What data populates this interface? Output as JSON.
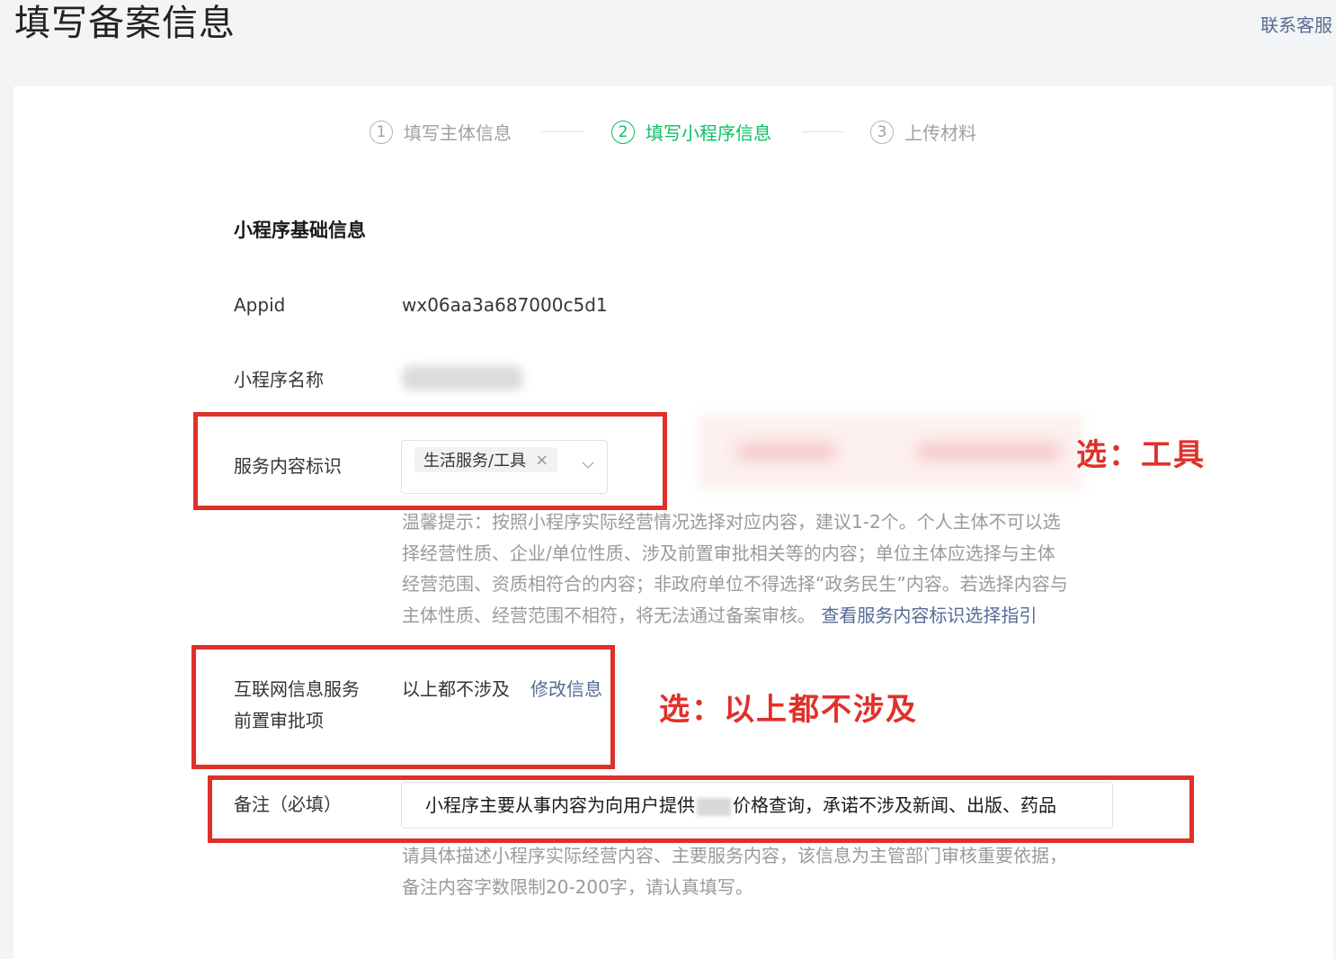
{
  "header": {
    "title": "填写备案信息",
    "contact": "联系客服"
  },
  "steps": [
    {
      "num": "1",
      "label": "填写主体信息",
      "active": false
    },
    {
      "num": "2",
      "label": "填写小程序信息",
      "active": true
    },
    {
      "num": "3",
      "label": "上传材料",
      "active": false
    }
  ],
  "section": {
    "title": "小程序基础信息"
  },
  "fields": {
    "appid": {
      "label": "Appid",
      "value": "wx06aa3a687000c5d1"
    },
    "name": {
      "label": "小程序名称"
    },
    "service": {
      "label": "服务内容标识",
      "tag": "生活服务/工具",
      "tag_close": "×",
      "hint": [
        "温馨提示：按照小程序实际经营情况选择对应内容，建议1-2个。个人主体不可以选",
        "择经营性质、企业/单位性质、涉及前置审批相关等的内容；单位主体应选择与主体",
        "经营范围、资质相符合的内容；非政府单位不得选择“政务民生”内容。若选择内容与",
        "主体性质、经营范围不相符，将无法通过备案审核。"
      ],
      "hint_link": "查看服务内容标识选择指引"
    },
    "pre_approval": {
      "label_line1": "互联网信息服务",
      "label_line2": "前置审批项",
      "value": "以上都不涉及",
      "edit_link": "修改信息"
    },
    "remark": {
      "label": "备注（必填）",
      "value_before": "小程序主要从事内容为向用户提供",
      "value_after": "价格查询，承诺不涉及新闻、出版、药品",
      "hint": [
        "请具体描述小程序实际经营内容、主要服务内容，该信息为主管部门审核重要依据，",
        "备注内容字数限制20-200字，请认真填写。"
      ]
    }
  },
  "annotations": {
    "service_choice": "选：工具",
    "approval_choice": "选：以上都不涉及",
    "color": "#e0302a"
  }
}
